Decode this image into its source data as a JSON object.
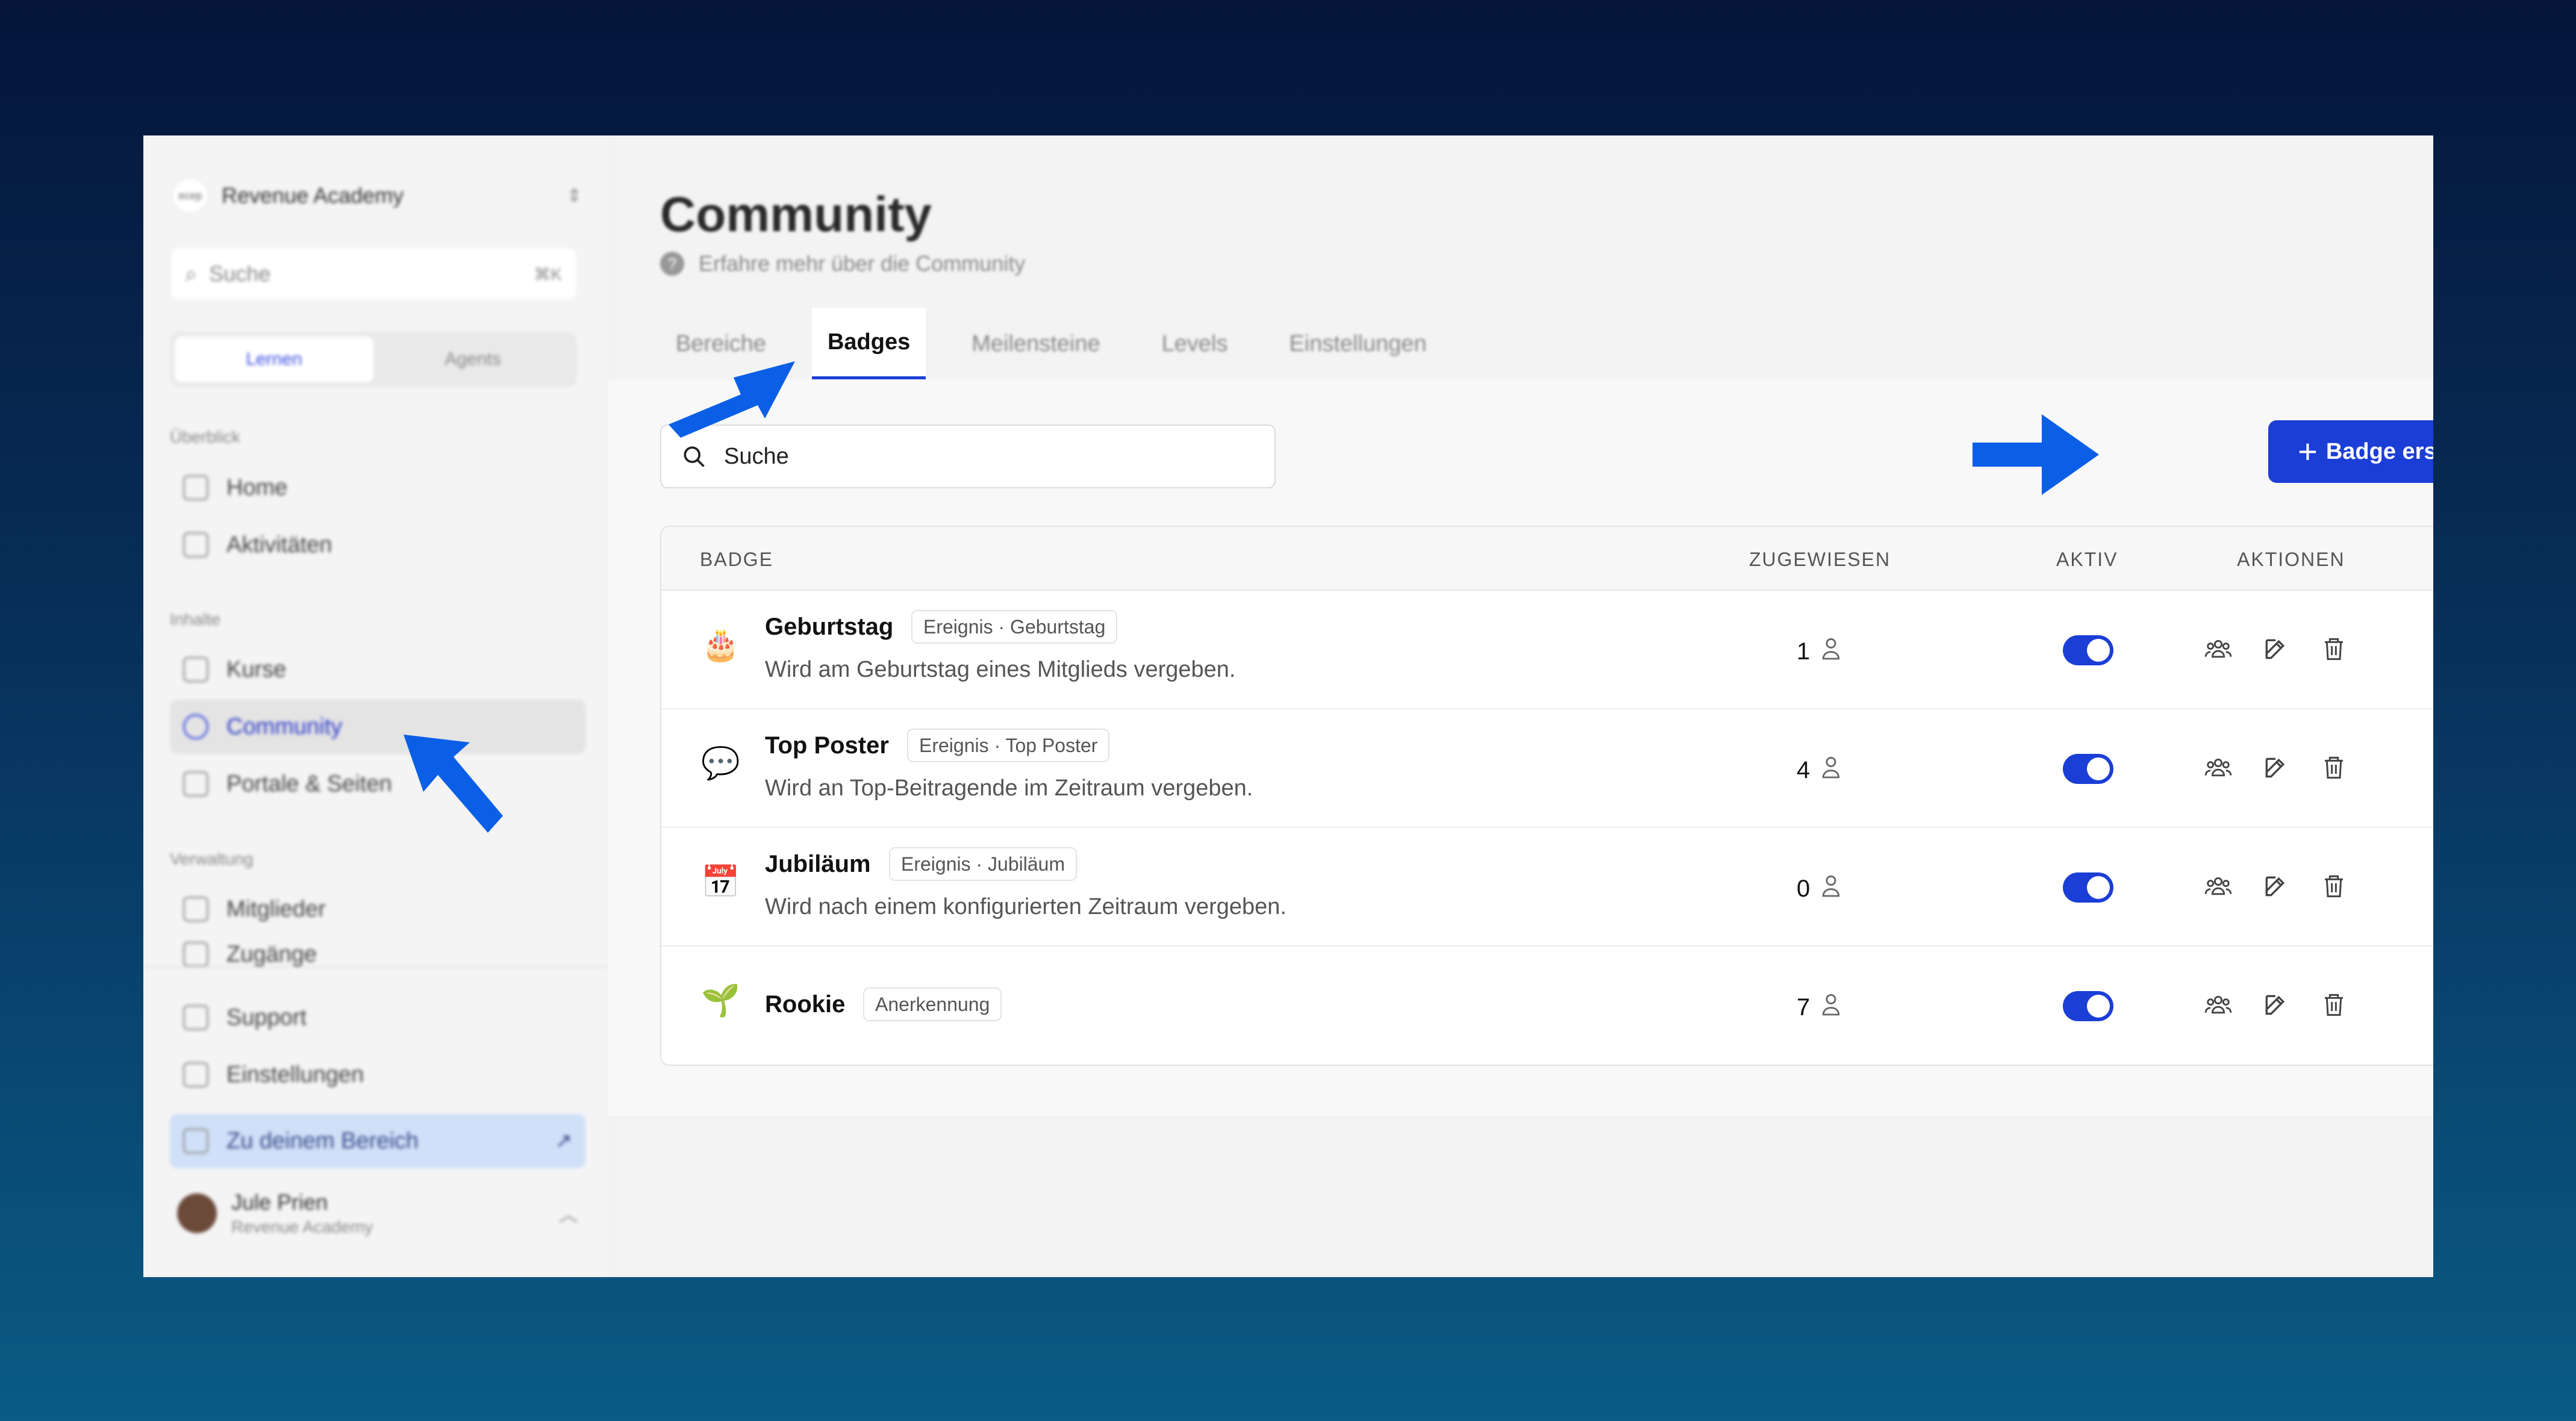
{
  "workspace": {
    "name": "Revenue Academy",
    "logo_text": "ecep"
  },
  "sidebar": {
    "search_placeholder": "Suche",
    "search_shortcut": "⌘K",
    "segments": [
      "Lernen",
      "Agents"
    ],
    "sections": [
      {
        "label": "Überblick",
        "items": [
          "Home",
          "Aktivitäten"
        ]
      },
      {
        "label": "Inhalte",
        "items": [
          "Kurse",
          "Community",
          "Portale & Seiten"
        ]
      },
      {
        "label": "Verwaltung",
        "items": [
          "Mitglieder",
          "Zugänge"
        ]
      }
    ],
    "bottom_items": [
      "Support",
      "Einstellungen",
      "Zu deinem Bereich"
    ],
    "active_item": "Community",
    "user": {
      "name": "Jule Prien",
      "org": "Revenue Academy"
    }
  },
  "page": {
    "title": "Community",
    "subtitle": "Erfahre mehr über die Community",
    "tabs": [
      "Bereiche",
      "Badges",
      "Meilensteine",
      "Levels",
      "Einstellungen"
    ],
    "active_tab": "Badges"
  },
  "toolbar": {
    "search_placeholder": "Suche",
    "create_label": "Badge erstellen"
  },
  "table": {
    "columns": {
      "badge": "BADGE",
      "assigned": "ZUGEWIESEN",
      "active": "AKTIV",
      "actions": "AKTIONEN"
    },
    "rows": [
      {
        "emoji": "🎂",
        "name": "Geburtstag",
        "tag": "Ereignis · Geburtstag",
        "description": "Wird am Geburtstag eines Mitglieds vergeben.",
        "assigned": "1",
        "active": true
      },
      {
        "emoji": "💬",
        "name": "Top Poster",
        "tag": "Ereignis · Top Poster",
        "description": "Wird an Top-Beitragende im Zeitraum vergeben.",
        "assigned": "4",
        "active": true
      },
      {
        "emoji": "📅",
        "name": "Jubiläum",
        "tag": "Ereignis · Jubiläum",
        "description": "Wird nach einem konfigurierten Zeitraum vergeben.",
        "assigned": "0",
        "active": true
      },
      {
        "emoji": "🌱",
        "name": "Rookie",
        "tag": "Anerkennung",
        "description": "",
        "assigned": "7",
        "active": true
      }
    ]
  },
  "colors": {
    "accent": "#1b3ed6",
    "annotation_arrow": "#0a5fe6",
    "background_top": "#05153a",
    "background_bottom": "#0a5b86"
  }
}
